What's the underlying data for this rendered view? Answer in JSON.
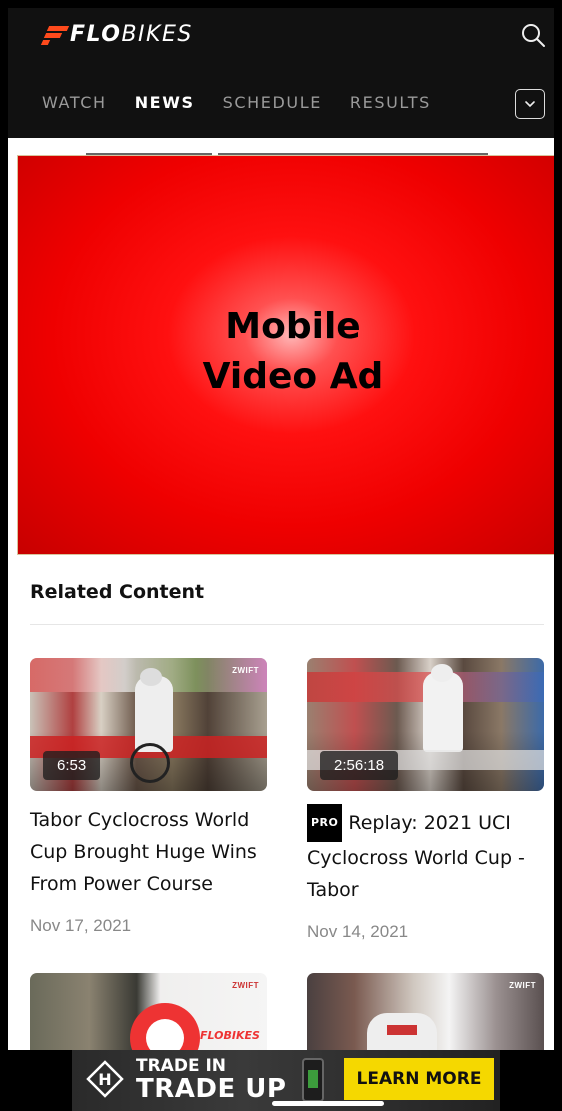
{
  "header": {
    "brand_bold": "FLO",
    "brand_light": "BIKES",
    "nav": [
      {
        "label": "WATCH",
        "active": false
      },
      {
        "label": "NEWS",
        "active": true
      },
      {
        "label": "SCHEDULE",
        "active": false
      },
      {
        "label": "RESULTS",
        "active": false
      }
    ],
    "icons": {
      "search": "search-icon",
      "dropdown": "chevron-down-icon"
    },
    "accent_color": "#ff4a1c"
  },
  "ad": {
    "line1": "Mobile",
    "line2": "Video Ad",
    "color": "#ff0000"
  },
  "related": {
    "heading": "Related Content",
    "cards": [
      {
        "duration": "6:53",
        "sponsor": "ZWIFT",
        "pro": false,
        "title": "Tabor Cyclocross World Cup Brought Huge Wins From Power Course",
        "date": "Nov 17, 2021"
      },
      {
        "duration": "2:56:18",
        "sponsor": "",
        "pro": true,
        "pro_label": "PRO",
        "title": "Replay: 2021 UCI Cyclocross World Cup - Tabor",
        "date": "Nov 14, 2021"
      },
      {
        "duration": "",
        "sponsor": "ZWIFT",
        "badge_text": "FLOBIKES",
        "pro": false,
        "title": "",
        "date": ""
      },
      {
        "duration": "",
        "sponsor": "ZWIFT",
        "pro": false,
        "title": "",
        "date": ""
      }
    ]
  },
  "banner": {
    "line1": "TRADE IN",
    "line2": "TRADE UP",
    "cta": "LEARN MORE",
    "cta_color": "#f5d800"
  }
}
